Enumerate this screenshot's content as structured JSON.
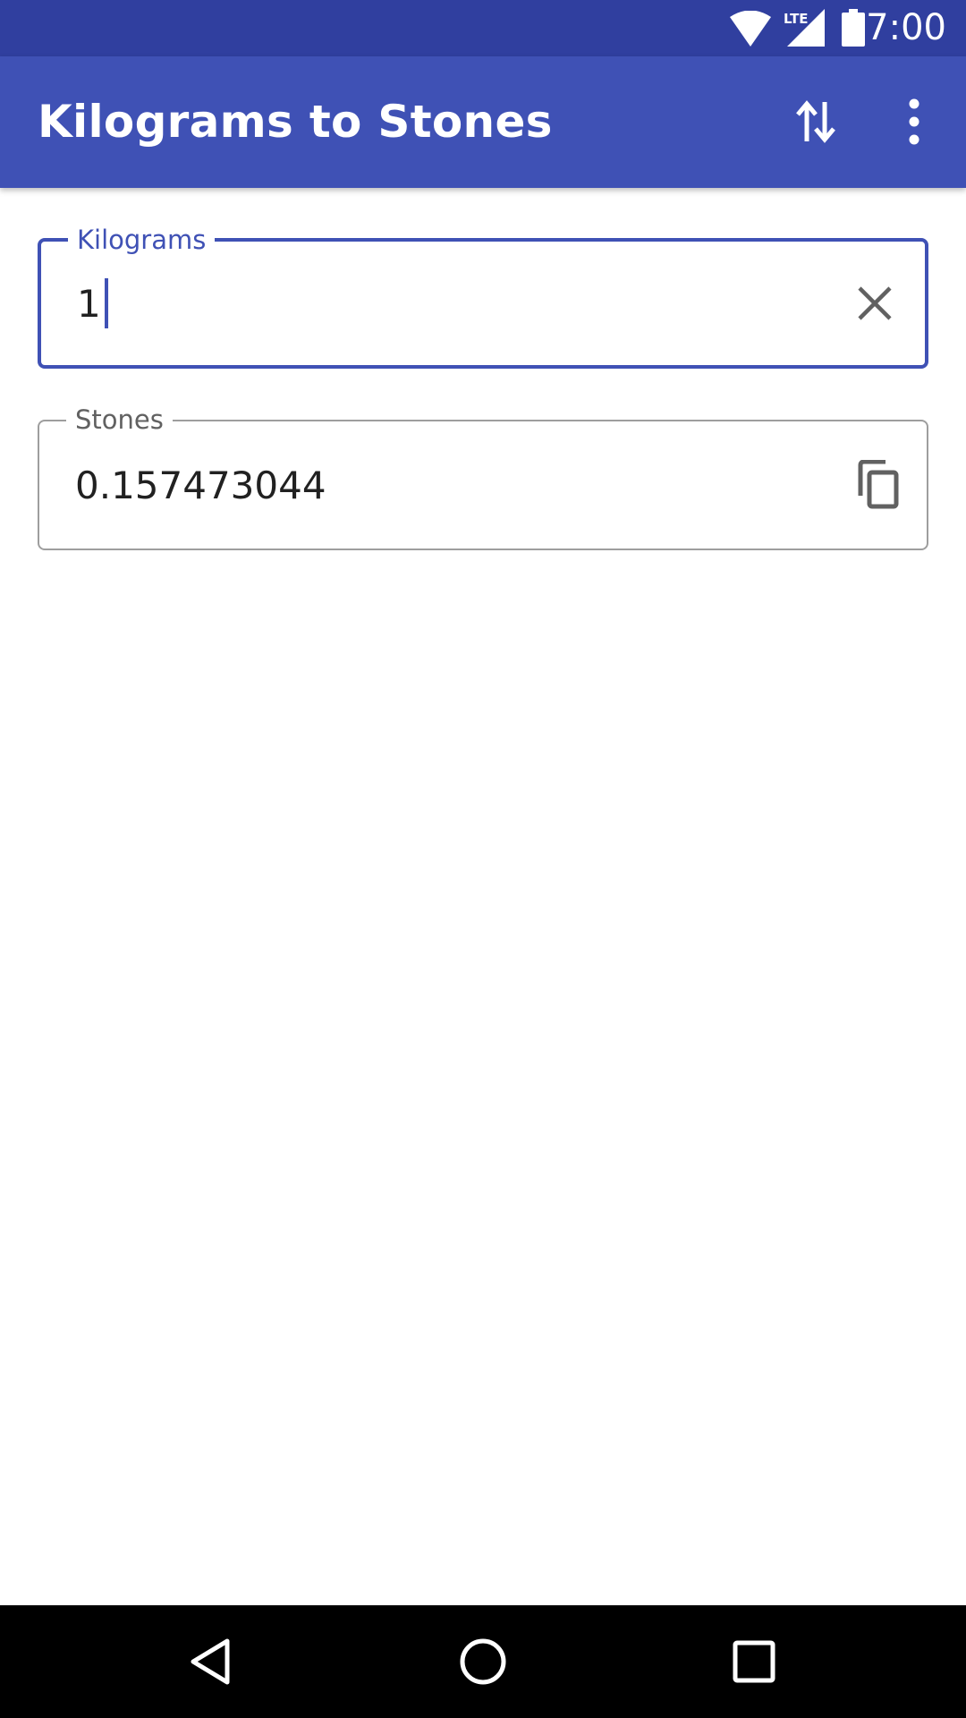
{
  "status_bar": {
    "time": "7:00",
    "network_label": "LTE",
    "icons": [
      "wifi-icon",
      "lte-signal-icon",
      "battery-icon"
    ]
  },
  "app_bar": {
    "title": "Kilograms to Stones",
    "actions": [
      "swap-units-icon",
      "more-options-icon"
    ]
  },
  "converter": {
    "input": {
      "label": "Kilograms",
      "value": "1",
      "focused": true,
      "trailing_icon": "clear-icon"
    },
    "output": {
      "label": "Stones",
      "value": "0.157473044",
      "trailing_icon": "copy-icon"
    }
  },
  "nav_bar": {
    "buttons": [
      "back-icon",
      "home-icon",
      "recents-icon"
    ]
  },
  "colors": {
    "primary": "#3f51b5",
    "primary_dark": "#303f9f",
    "outline": "#9e9e9e",
    "text": "#212121"
  }
}
